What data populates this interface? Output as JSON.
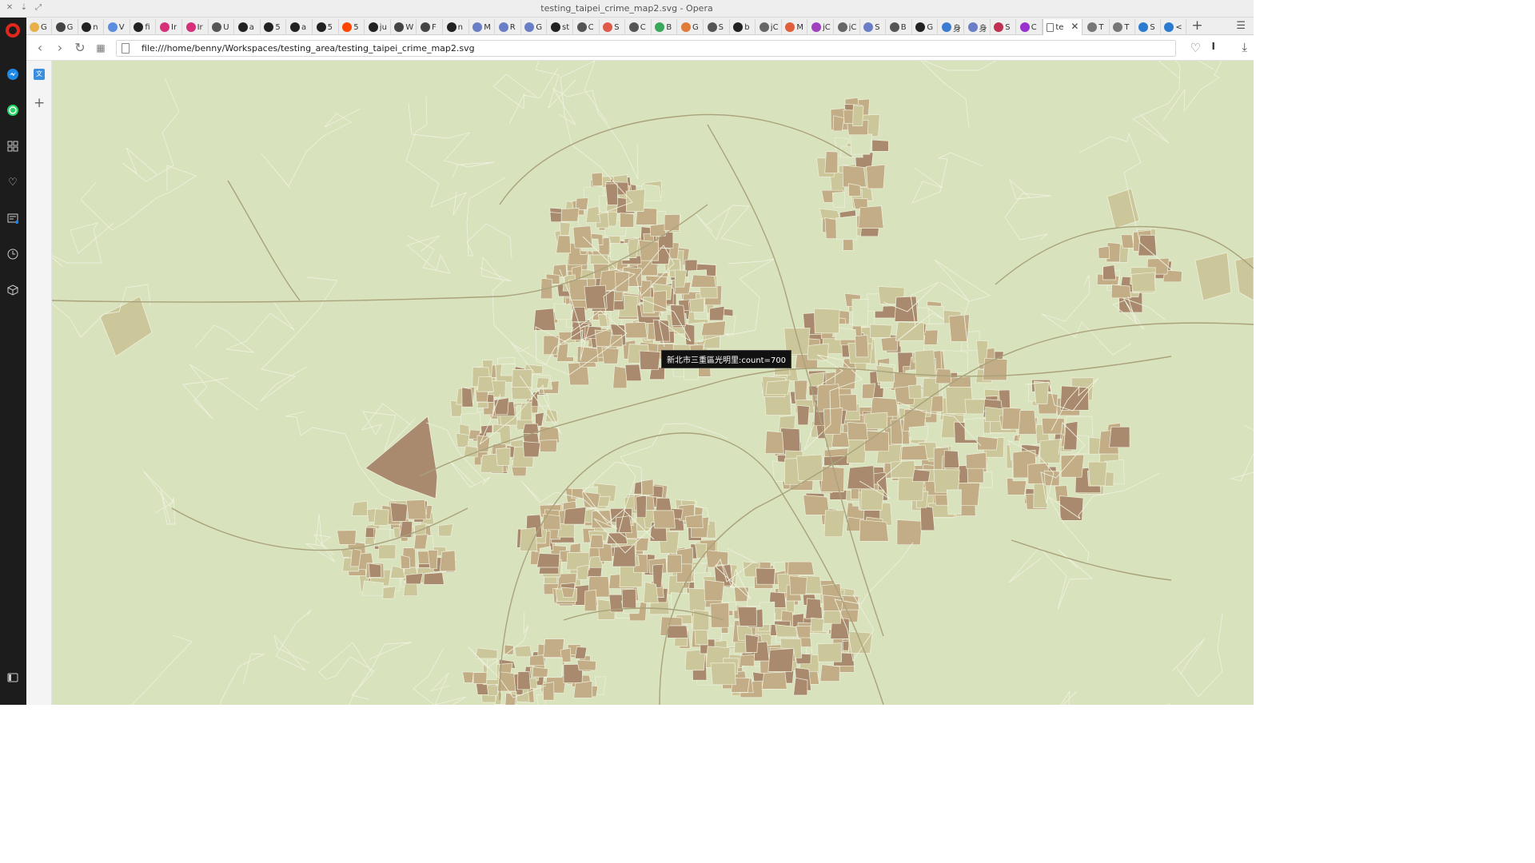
{
  "window": {
    "title": "testing_taipei_crime_map2.svg - Opera"
  },
  "tabs": [
    {
      "label": "G",
      "color": "#e8b04a"
    },
    {
      "label": "G",
      "color": "#444444"
    },
    {
      "label": "n",
      "color": "#222222"
    },
    {
      "label": "V",
      "color": "#5a8de0"
    },
    {
      "label": "fi",
      "color": "#222222"
    },
    {
      "label": "Ir",
      "color": "#d6307a"
    },
    {
      "label": "Ir",
      "color": "#d6307a"
    },
    {
      "label": "U",
      "color": "#555555"
    },
    {
      "label": "a",
      "color": "#222222"
    },
    {
      "label": "5",
      "color": "#222222"
    },
    {
      "label": "a",
      "color": "#222222"
    },
    {
      "label": "5",
      "color": "#222222"
    },
    {
      "label": "5",
      "color": "#ff4500"
    },
    {
      "label": "ju",
      "color": "#222222"
    },
    {
      "label": "W",
      "color": "#444444"
    },
    {
      "label": "F",
      "color": "#444444"
    },
    {
      "label": "n",
      "color": "#222222"
    },
    {
      "label": "M",
      "color": "#6a7ec8"
    },
    {
      "label": "R",
      "color": "#6a7ec8"
    },
    {
      "label": "G",
      "color": "#6a7ec8"
    },
    {
      "label": "st",
      "color": "#222222"
    },
    {
      "label": "C",
      "color": "#555555"
    },
    {
      "label": "S",
      "color": "#e05a4a"
    },
    {
      "label": "C",
      "color": "#555555"
    },
    {
      "label": "B",
      "color": "#3aa85a"
    },
    {
      "label": "G",
      "color": "#e07b39"
    },
    {
      "label": "S",
      "color": "#555555"
    },
    {
      "label": "b",
      "color": "#222222"
    },
    {
      "label": "jC",
      "color": "#666666"
    },
    {
      "label": "M",
      "color": "#e0603a"
    },
    {
      "label": "jC",
      "color": "#a040c0"
    },
    {
      "label": "jC",
      "color": "#666666"
    },
    {
      "label": "S",
      "color": "#6a7ec8"
    },
    {
      "label": "B",
      "color": "#555555"
    },
    {
      "label": "G",
      "color": "#222222"
    },
    {
      "label": "身",
      "color": "#3a7ad0"
    },
    {
      "label": "身",
      "color": "#6a7ec8"
    },
    {
      "label": "S",
      "color": "#c03050"
    },
    {
      "label": "C",
      "color": "#9b30d0"
    }
  ],
  "active_tab": {
    "label": "te",
    "color": "#777777",
    "close": "✕"
  },
  "tabs_after": [
    {
      "label": "T",
      "color": "#777777"
    },
    {
      "label": "T",
      "color": "#777777"
    },
    {
      "label": "S",
      "color": "#2a7ad0"
    },
    {
      "label": "<",
      "color": "#2a7ad0"
    }
  ],
  "new_tab_label": "+",
  "address_bar": {
    "url": "file:///home/benny/Workspaces/testing_area/testing_taipei_crime_map2.svg"
  },
  "map": {
    "tooltip": "新北市三重區光明里:count=700",
    "colors": {
      "background": "#d8e2bd",
      "low": "#ccc79a",
      "mid": "#c2ad86",
      "high": "#a98a6e",
      "highest": "#8c7373",
      "road": "#a9a27a",
      "boundary": "#eef0dc"
    }
  }
}
